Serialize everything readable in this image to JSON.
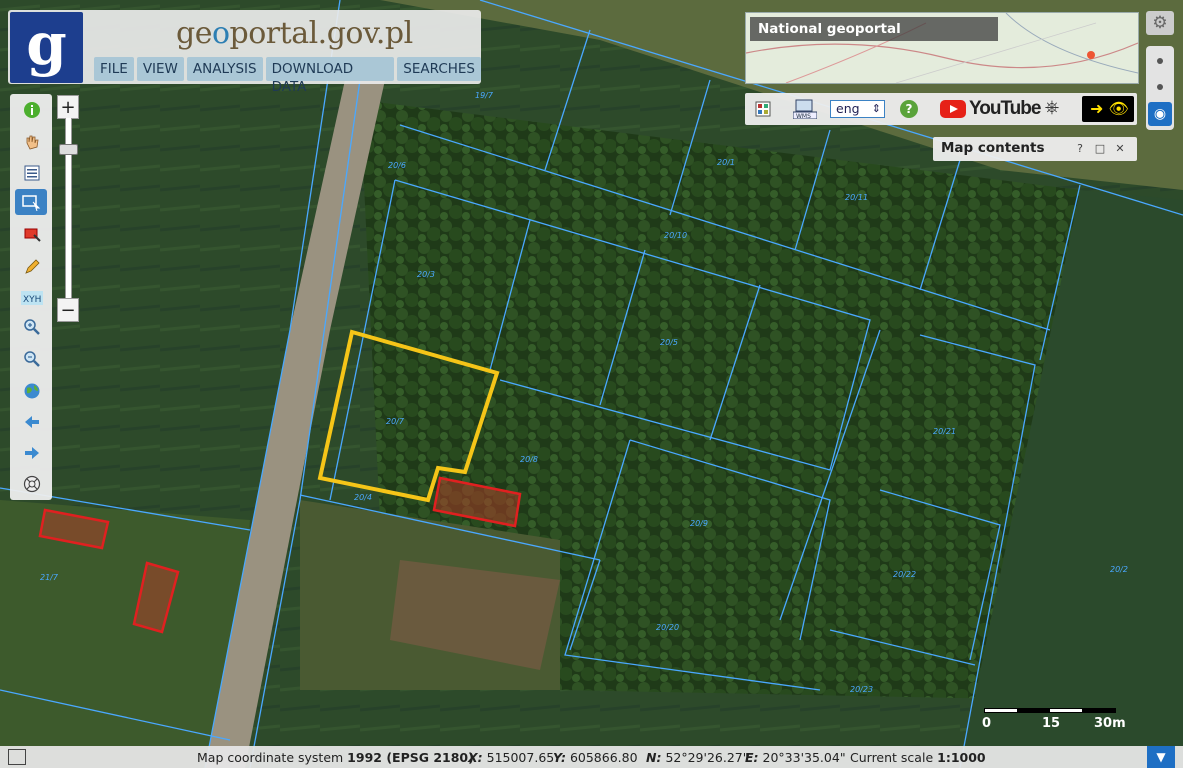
{
  "header": {
    "logo_letter": "g",
    "title_prefix": "ge",
    "title_accent": "o",
    "title_rest": "portal.gov.pl",
    "menu": [
      "FILE",
      "VIEW",
      "ANALYSIS",
      "DOWNLOAD DATA",
      "SEARCHES"
    ]
  },
  "overview": {
    "title": "National geoportal"
  },
  "topbar": {
    "language": "eng",
    "help": "?",
    "youtube": "YouTube"
  },
  "map_contents": {
    "title": "Map contents",
    "help": "?",
    "maximize": "□",
    "close": "✕"
  },
  "parcels": [
    {
      "label": "20/7",
      "kind": "highlight"
    },
    {
      "label": "20/8",
      "kind": "normal"
    },
    {
      "label": "20/4",
      "kind": "normal"
    },
    {
      "label": "20/6",
      "kind": "normal"
    },
    {
      "label": "20/3",
      "kind": "normal"
    },
    {
      "label": "20/9",
      "kind": "normal"
    },
    {
      "label": "20/10",
      "kind": "normal"
    },
    {
      "label": "20/1",
      "kind": "normal"
    },
    {
      "label": "20/11",
      "kind": "normal"
    },
    {
      "label": "20/5",
      "kind": "normal"
    },
    {
      "label": "20/21",
      "kind": "normal"
    },
    {
      "label": "20/20",
      "kind": "normal"
    },
    {
      "label": "20/22",
      "kind": "normal"
    },
    {
      "label": "20/23",
      "kind": "normal"
    },
    {
      "label": "20/2",
      "kind": "normal"
    },
    {
      "label": "21/7",
      "kind": "normal"
    },
    {
      "label": "19/7",
      "kind": "normal"
    }
  ],
  "scale_bar": {
    "labels": [
      "0",
      "15",
      "30m"
    ]
  },
  "status": {
    "crs_label": "Map coordinate system",
    "crs_value": "1992 (EPSG 2180)",
    "x_label": "X:",
    "x_value": "515007.65",
    "y_label": "Y:",
    "y_value": "605866.80",
    "n_label": "N:",
    "n_value": "52°29'26.27\"",
    "e_label": "E:",
    "e_value": "20°33'35.04\"",
    "scale_label": "Current scale",
    "scale_value": "1:1000"
  },
  "colors": {
    "parcel_line": "#4aa8ff",
    "highlight": "#f5c518",
    "building": "#e02020",
    "menu_bg": "#aac7d6",
    "logo_bg": "#1d3e8e"
  }
}
